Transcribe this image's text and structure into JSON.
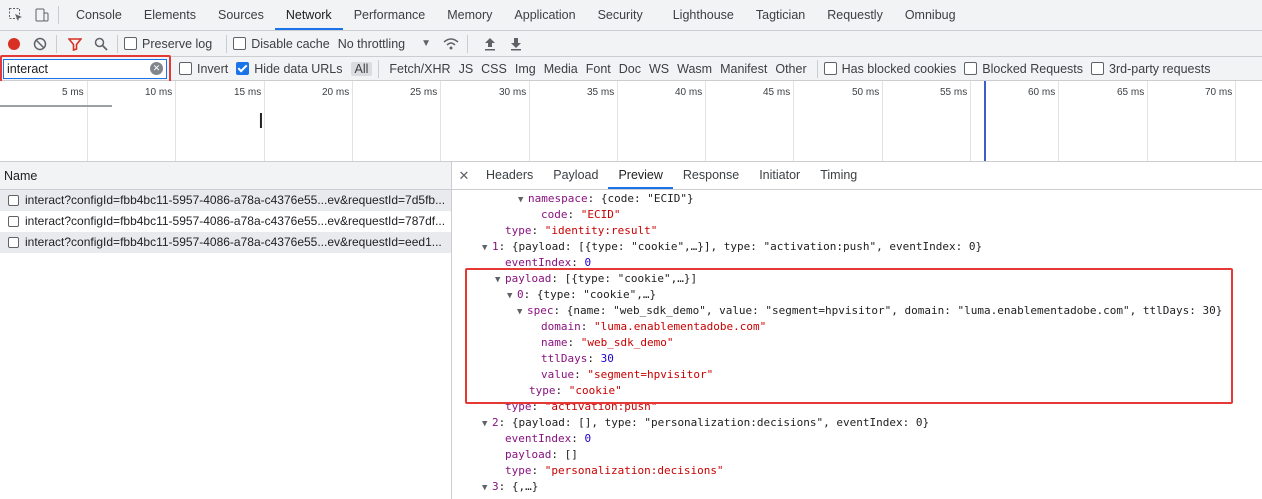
{
  "tabs": [
    "Console",
    "Elements",
    "Sources",
    "Network",
    "Performance",
    "Memory",
    "Application",
    "Security",
    "Lighthouse",
    "Tagtician",
    "Requestly",
    "Omnibug"
  ],
  "active_tab": "Network",
  "toolbar": {
    "preserve_log": "Preserve log",
    "disable_cache": "Disable cache",
    "throttling": "No throttling"
  },
  "filter": {
    "value": "interact",
    "invert": "Invert",
    "hide_data_urls": "Hide data URLs",
    "types": [
      "All",
      "Fetch/XHR",
      "JS",
      "CSS",
      "Img",
      "Media",
      "Font",
      "Doc",
      "WS",
      "Wasm",
      "Manifest",
      "Other"
    ],
    "blocked_cookies": "Has blocked cookies",
    "blocked_requests": "Blocked Requests",
    "third_party": "3rd-party requests"
  },
  "timeline_ticks": [
    "5 ms",
    "10 ms",
    "15 ms",
    "20 ms",
    "25 ms",
    "30 ms",
    "35 ms",
    "40 ms",
    "45 ms",
    "50 ms",
    "55 ms",
    "60 ms",
    "65 ms",
    "70 ms"
  ],
  "list": {
    "header": "Name",
    "requests": [
      "interact?configId=fbb4bc11-5957-4086-a78a-c4376e55...ev&requestId=7d5fb...",
      "interact?configId=fbb4bc11-5957-4086-a78a-c4376e55...ev&requestId=787df...",
      "interact?configId=fbb4bc11-5957-4086-a78a-c4376e55...ev&requestId=eed1..."
    ]
  },
  "detail_tabs": [
    "Headers",
    "Payload",
    "Preview",
    "Response",
    "Initiator",
    "Timing"
  ],
  "active_detail_tab": "Preview",
  "preview": {
    "l1_key": "namespace",
    "l1_val": "{code: \"ECID\"}",
    "l2_key": "code",
    "l2_val": "\"ECID\"",
    "l3_key": "type",
    "l3_val": "\"identity:result\"",
    "l4_key": "1",
    "l4_val": "{payload: [{type: \"cookie\",…}], type: \"activation:push\", eventIndex: 0}",
    "l5_key": "eventIndex",
    "l5_val": "0",
    "l6_key": "payload",
    "l6_val": "[{type: \"cookie\",…}]",
    "l7_key": "0",
    "l7_val": "{type: \"cookie\",…}",
    "l8_key": "spec",
    "l8_val": "{name: \"web_sdk_demo\", value: \"segment=hpvisitor\", domain: \"luma.enablementadobe.com\", ttlDays: 30}",
    "l9_key": "domain",
    "l9_val": "\"luma.enablementadobe.com\"",
    "l10_key": "name",
    "l10_val": "\"web_sdk_demo\"",
    "l11_key": "ttlDays",
    "l11_val": "30",
    "l12_key": "value",
    "l12_val": "\"segment=hpvisitor\"",
    "l13_key": "type",
    "l13_val": "\"cookie\"",
    "l14_key": "type",
    "l14_val": "\"activation:push\"",
    "l15_key": "2",
    "l15_val": "{payload: [], type: \"personalization:decisions\", eventIndex: 0}",
    "l16_key": "eventIndex",
    "l16_val": "0",
    "l17_key": "payload",
    "l17_val": "[]",
    "l18_key": "type",
    "l18_val": "\"personalization:decisions\"",
    "l19_key": "3",
    "l19_val": "{,…}"
  },
  "colors": {
    "accent": "#1a73e8",
    "highlight": "#e53935",
    "record": "#d93025",
    "filter_icon": "#d93025"
  }
}
